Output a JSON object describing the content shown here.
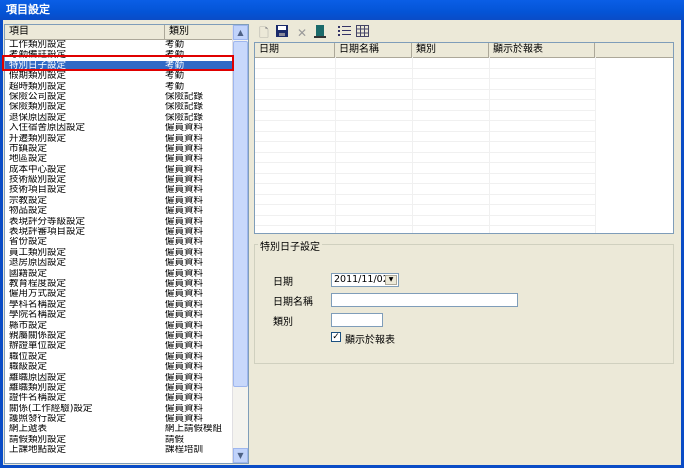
{
  "window": {
    "title": "項目設定"
  },
  "list": {
    "headers": [
      "項目",
      "類別"
    ],
    "rows": [
      [
        "工作類別設定",
        "考勤"
      ],
      [
        "考勤備註設定",
        "考勤"
      ],
      [
        "特別日子設定",
        "考勤"
      ],
      [
        "假期類別設定",
        "考勤"
      ],
      [
        "超時類別設定",
        "考勤"
      ],
      [
        "保險公司設定",
        "保險記錄"
      ],
      [
        "保險類別設定",
        "保險記錄"
      ],
      [
        "退保原因設定",
        "保險記錄"
      ],
      [
        "入住宿舍原因設定",
        "僱員資料"
      ],
      [
        "升遷類別設定",
        "僱員資料"
      ],
      [
        "市鎮設定",
        "僱員資料"
      ],
      [
        "地區設定",
        "僱員資料"
      ],
      [
        "成本中心設定",
        "僱員資料"
      ],
      [
        "技術級別設定",
        "僱員資料"
      ],
      [
        "技術項目設定",
        "僱員資料"
      ],
      [
        "宗教設定",
        "僱員資料"
      ],
      [
        "物品設定",
        "僱員資料"
      ],
      [
        "表現評分等級設定",
        "僱員資料"
      ],
      [
        "表現評審項目設定",
        "僱員資料"
      ],
      [
        "省份設定",
        "僱員資料"
      ],
      [
        "員工類別設定",
        "僱員資料"
      ],
      [
        "退房原因設定",
        "僱員資料"
      ],
      [
        "國籍設定",
        "僱員資料"
      ],
      [
        "教育程度設定",
        "僱員資料"
      ],
      [
        "僱用方式設定",
        "僱員資料"
      ],
      [
        "學科名稱設定",
        "僱員資料"
      ],
      [
        "學院名稱設定",
        "僱員資料"
      ],
      [
        "縣市設定",
        "僱員資料"
      ],
      [
        "親屬關係設定",
        "僱員資料"
      ],
      [
        "辦證單位設定",
        "僱員資料"
      ],
      [
        "職位設定",
        "僱員資料"
      ],
      [
        "職級設定",
        "僱員資料"
      ],
      [
        "離職原因設定",
        "僱員資料"
      ],
      [
        "離職類別設定",
        "僱員資料"
      ],
      [
        "證件名稱設定",
        "僱員資料"
      ],
      [
        "關係(工作經驗)設定",
        "僱員資料"
      ],
      [
        "護照發行設定",
        "僱員資料"
      ],
      [
        "網上遞表",
        "網上請假模組"
      ],
      [
        "請假類別設定",
        "請假"
      ],
      [
        "上課地點設定",
        "課程培訓"
      ]
    ]
  },
  "toolbar": {
    "new_icon": "new-document-icon",
    "save_icon": "save-icon",
    "delete_icon": "delete-icon",
    "exit_icon": "exit-door-icon",
    "list_icon": "list-view-icon",
    "grid_icon": "grid-view-icon"
  },
  "grid": {
    "headers": [
      "日期",
      "日期名稱",
      "類別",
      "顯示於報表"
    ]
  },
  "form": {
    "group_title": "特別日子設定",
    "date_label": "日期",
    "date_value": "2011/11/02",
    "name_label": "日期名稱",
    "name_value": "",
    "type_label": "類別",
    "type_value": "",
    "show_label": "顯示於報表",
    "show_checked": true
  }
}
